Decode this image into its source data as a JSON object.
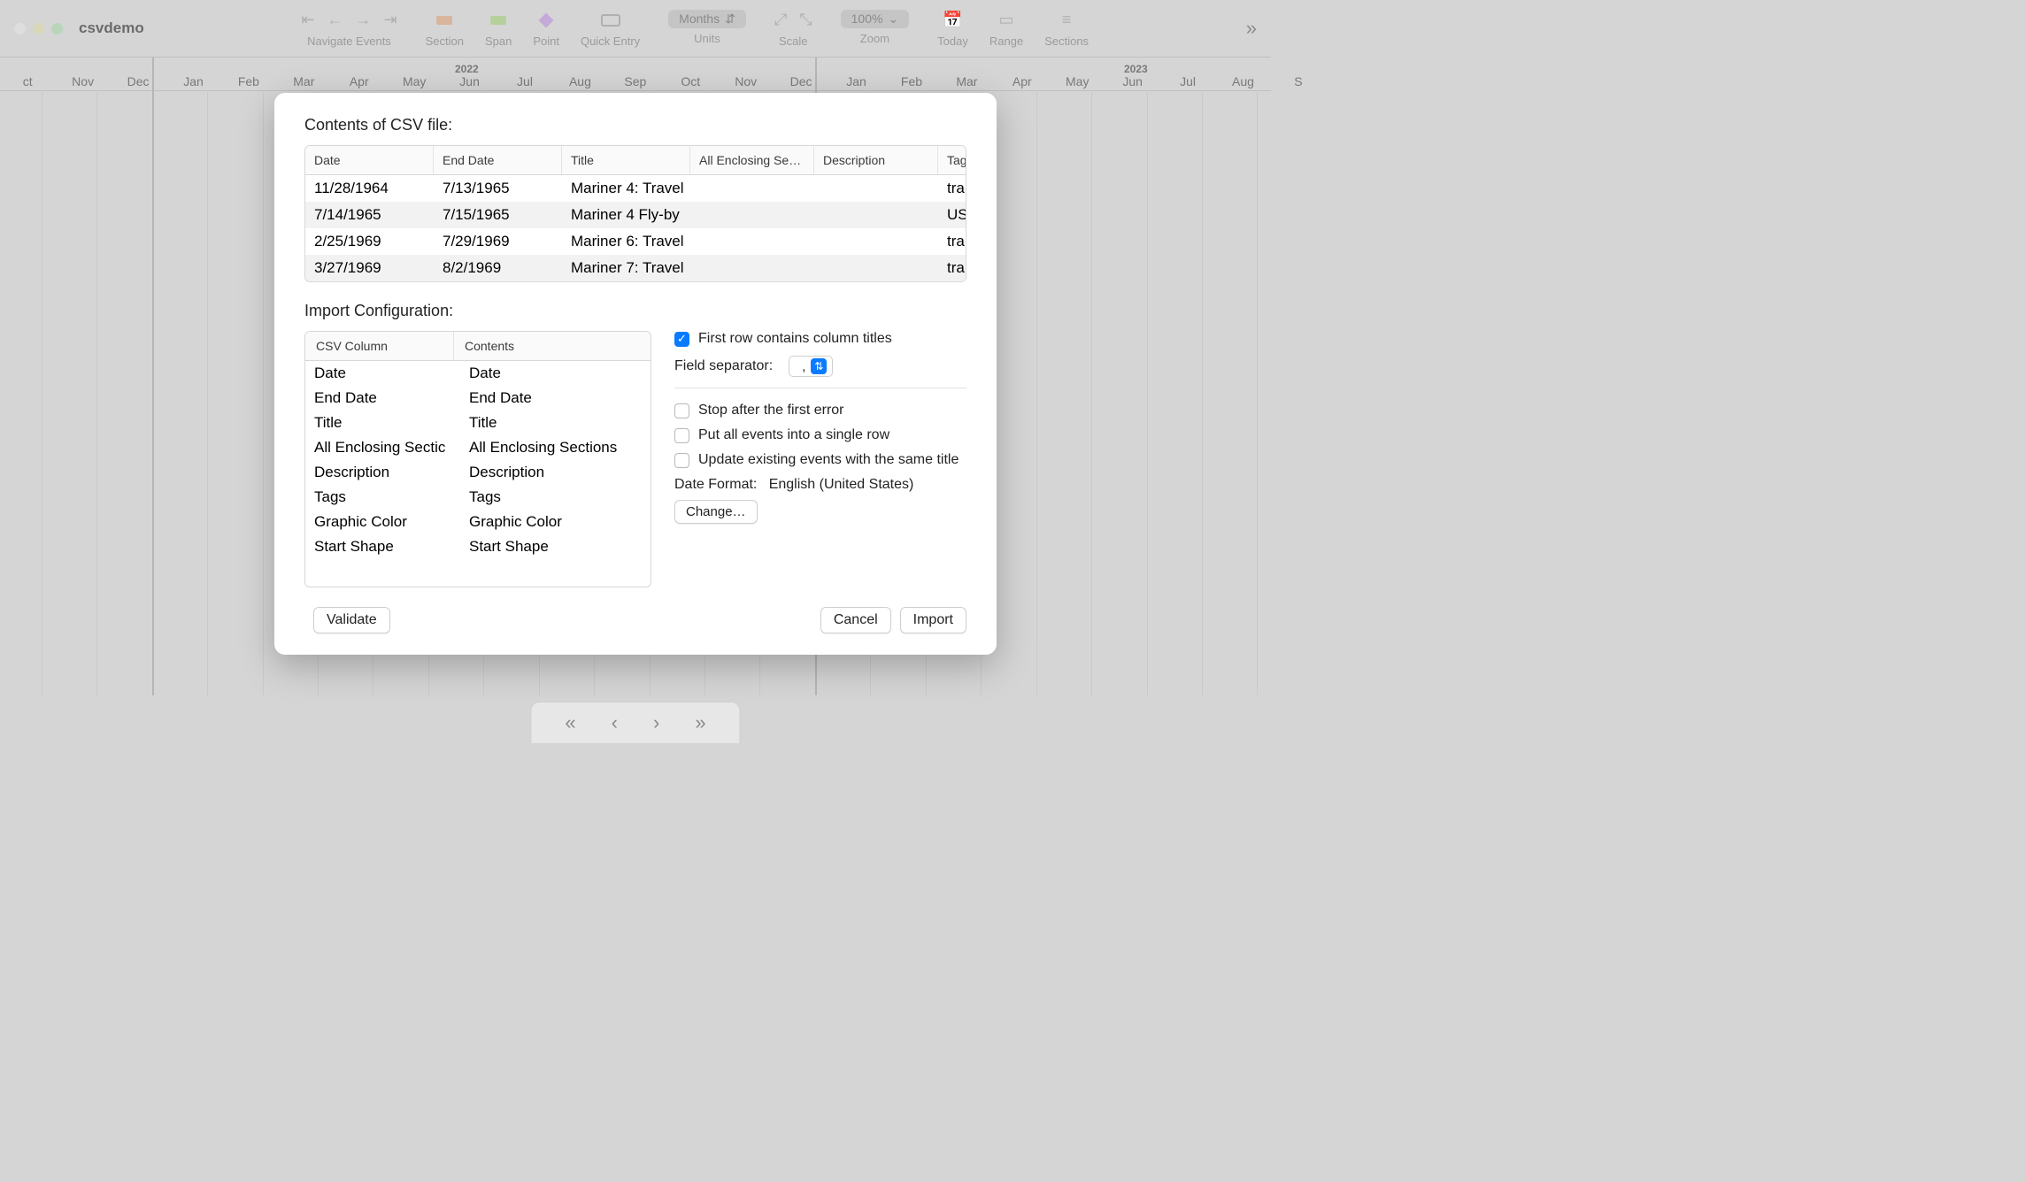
{
  "app_name": "csvdemo",
  "toolbar": {
    "navigate_label": "Navigate Events",
    "section_label": "Section",
    "span_label": "Span",
    "point_label": "Point",
    "quick_label": "Quick Entry",
    "units_label": "Units",
    "units_value": "Months",
    "scale_label": "Scale",
    "zoom_label": "Zoom",
    "zoom_value": "100% ",
    "today_label": "Today",
    "range_label": "Range",
    "sections_label": "Sections"
  },
  "timeline": {
    "years": [
      "2022",
      "2023"
    ],
    "months": [
      "ct",
      "Nov",
      "Dec",
      "Jan",
      "Feb",
      "Mar",
      "Apr",
      "May",
      "Jun",
      "Jul",
      "Aug",
      "Sep",
      "Oct",
      "Nov",
      "Dec",
      "Jan",
      "Feb",
      "Mar",
      "Apr",
      "May",
      "Jun",
      "Jul",
      "Aug",
      "S"
    ]
  },
  "modal": {
    "csv_title": "Contents of CSV file:",
    "headers": [
      "Date",
      "End Date",
      "Title",
      "All Enclosing Se…",
      "Description",
      "Tags"
    ],
    "rows": [
      {
        "date": "11/28/1964",
        "end": "7/13/1965",
        "title": "Mariner 4: Travel",
        "all": "",
        "desc": "",
        "tags": "trans"
      },
      {
        "date": "7/14/1965",
        "end": "7/15/1965",
        "title": "Mariner 4 Fly-by",
        "all": "",
        "desc": "",
        "tags": "USA"
      },
      {
        "date": "2/25/1969",
        "end": "7/29/1969",
        "title": "Mariner 6: Travel",
        "all": "",
        "desc": "",
        "tags": "trans"
      },
      {
        "date": "3/27/1969",
        "end": "8/2/1969",
        "title": "Mariner 7: Travel",
        "all": "",
        "desc": "",
        "tags": "trans"
      }
    ],
    "config_title": "Import Configuration:",
    "config_headers": [
      "CSV Column",
      "Contents"
    ],
    "config_rows": [
      {
        "c": "Date",
        "v": "Date"
      },
      {
        "c": "End Date",
        "v": "End Date"
      },
      {
        "c": "Title",
        "v": "Title"
      },
      {
        "c": "All Enclosing Sectic",
        "v": "All Enclosing Sections"
      },
      {
        "c": "Description",
        "v": "Description"
      },
      {
        "c": "Tags",
        "v": "Tags"
      },
      {
        "c": "Graphic Color",
        "v": "Graphic Color"
      },
      {
        "c": "Start Shape",
        "v": "Start Shape"
      }
    ],
    "opt_first_row": "First row contains column titles",
    "opt_sep_label": "Field separator:",
    "opt_sep_value": ",",
    "opt_stop": "Stop after the first error",
    "opt_single": "Put all events into a single row",
    "opt_update": "Update existing events with the same title",
    "date_format_label": "Date Format:",
    "date_format_value": "English (United States)",
    "change_btn": "Change…",
    "validate_btn": "Validate",
    "cancel_btn": "Cancel",
    "import_btn": "Import"
  }
}
